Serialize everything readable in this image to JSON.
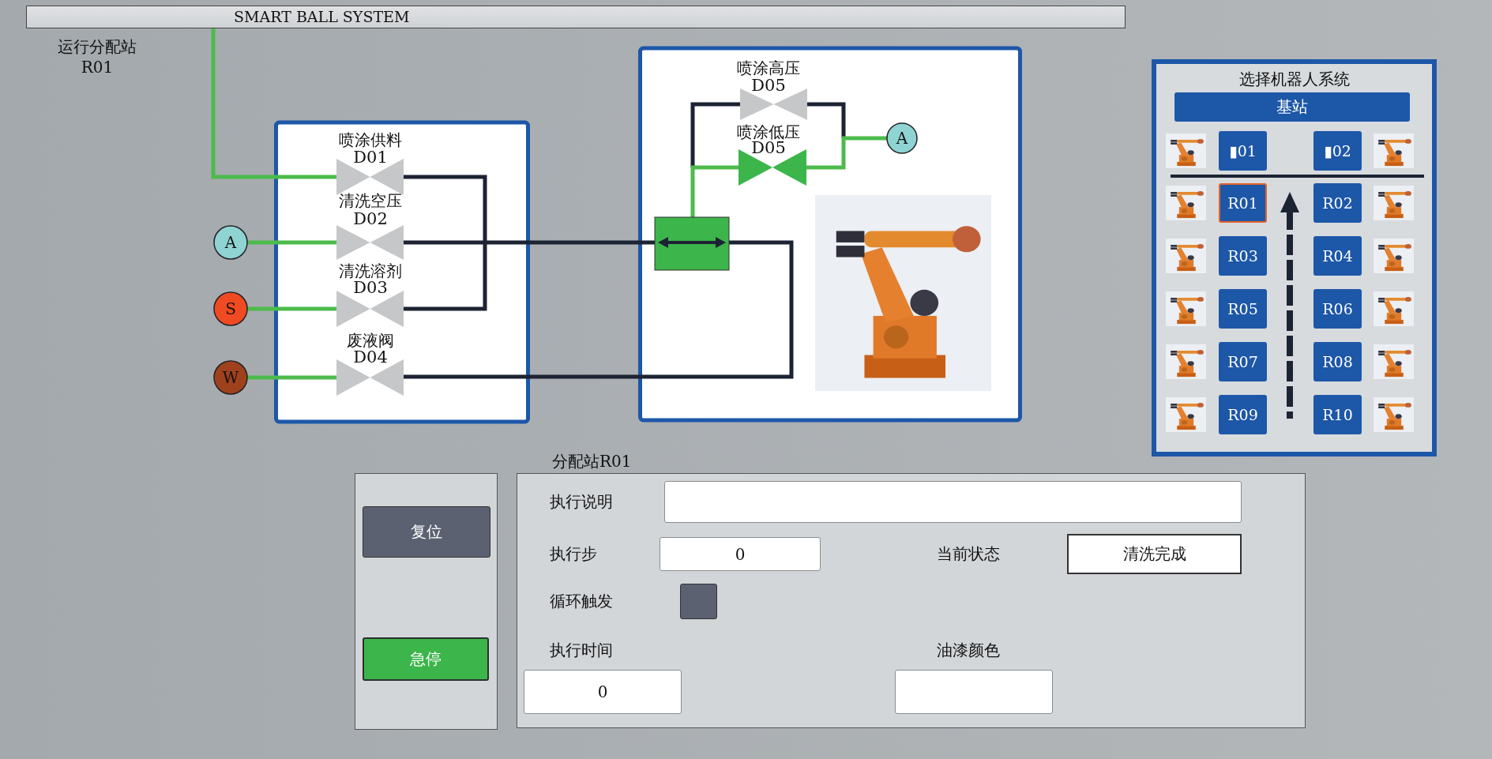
{
  "title": "SMART BALL SYSTEM",
  "station_label": [
    "运行分配站",
    "R01"
  ],
  "valves": [
    {
      "name": "喷涂供料",
      "code": "D01",
      "open": false
    },
    {
      "name": "清洗空压",
      "code": "D02",
      "open": false
    },
    {
      "name": "清洗溶剂",
      "code": "D03",
      "open": false
    },
    {
      "name": "废液阀",
      "code": "D04",
      "open": false
    },
    {
      "name": "喷涂高压",
      "code": "D05",
      "open": false
    },
    {
      "name": "喷涂低压",
      "code": "D05",
      "open": true
    }
  ],
  "sources": [
    {
      "letter": "A",
      "color": "#8fd3d3"
    },
    {
      "letter": "S",
      "color": "#f04a23"
    },
    {
      "letter": "W",
      "color": "#a0411d"
    },
    {
      "letter": "A",
      "color": "#8fd3d3"
    }
  ],
  "robot_panel": {
    "title": "选择机器人系统",
    "base_button": "基站",
    "stations": [
      {
        "label": "▮01",
        "selected": false
      },
      {
        "label": "▮02",
        "selected": false
      },
      {
        "label": "R01",
        "selected": true
      },
      {
        "label": "R02",
        "selected": false
      },
      {
        "label": "R03",
        "selected": false
      },
      {
        "label": "R04",
        "selected": false
      },
      {
        "label": "R05",
        "selected": false
      },
      {
        "label": "R06",
        "selected": false
      },
      {
        "label": "R07",
        "selected": false
      },
      {
        "label": "R08",
        "selected": false
      },
      {
        "label": "R09",
        "selected": false
      },
      {
        "label": "R10",
        "selected": false
      }
    ]
  },
  "controls": {
    "reset": "复位",
    "emergency_stop": "急停"
  },
  "station_panel": {
    "title": "分配站R01",
    "description": {
      "label": "执行说明"
    },
    "step": {
      "label": "执行步",
      "value": "0"
    },
    "state": {
      "label": "当前状态",
      "value": "清洗完成"
    },
    "loop_trigger": {
      "label": "循环触发",
      "on": false
    },
    "exec_time": {
      "label": "执行时间",
      "value": "0"
    },
    "paint_color": {
      "label": "油漆颜色"
    }
  }
}
